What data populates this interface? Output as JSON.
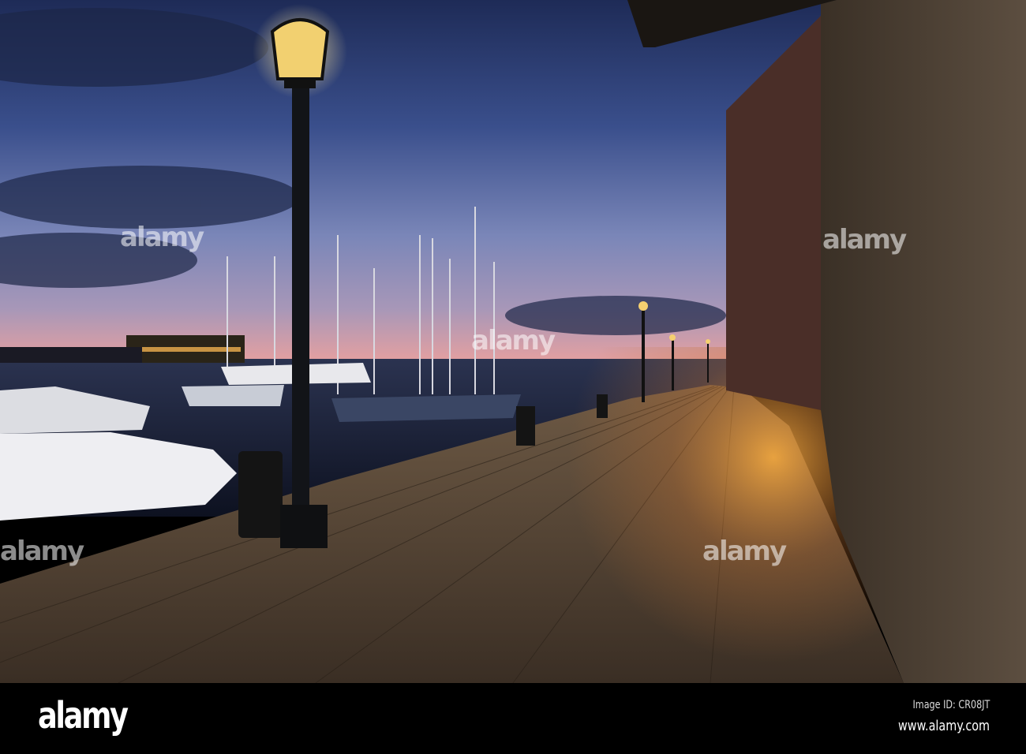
{
  "footer": {
    "logo": "alamy",
    "image_id": "Image ID: CR08JT",
    "url": "www.alamy.com"
  },
  "watermark": "alamy"
}
